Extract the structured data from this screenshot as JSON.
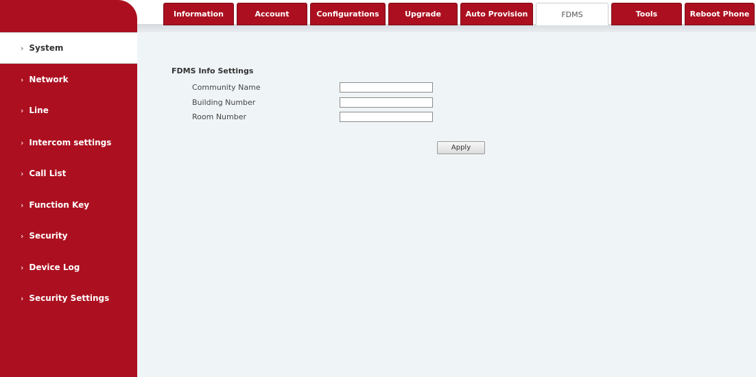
{
  "tabs": [
    {
      "label": "Information",
      "active": false
    },
    {
      "label": "Account",
      "active": false
    },
    {
      "label": "Configurations",
      "active": false
    },
    {
      "label": "Upgrade",
      "active": false
    },
    {
      "label": "Auto Provision",
      "active": false
    },
    {
      "label": "FDMS",
      "active": true
    },
    {
      "label": "Tools",
      "active": false
    },
    {
      "label": "Reboot Phone",
      "active": false
    }
  ],
  "sidebar": {
    "chevron": "›",
    "items": [
      {
        "label": "System",
        "active": true
      },
      {
        "label": "Network",
        "active": false
      },
      {
        "label": "Line",
        "active": false
      },
      {
        "label": "Intercom settings",
        "active": false
      },
      {
        "label": "Call List",
        "active": false
      },
      {
        "label": "Function Key",
        "active": false
      },
      {
        "label": "Security",
        "active": false
      },
      {
        "label": "Device Log",
        "active": false
      },
      {
        "label": "Security Settings",
        "active": false
      }
    ]
  },
  "form": {
    "title": "FDMS Info Settings",
    "fields": [
      {
        "label": "Community Name",
        "value": ""
      },
      {
        "label": "Building Number",
        "value": ""
      },
      {
        "label": "Room Number",
        "value": ""
      }
    ],
    "apply_label": "Apply"
  },
  "colors": {
    "brand": "#ac1020",
    "content_bg": "#eff4f6"
  }
}
